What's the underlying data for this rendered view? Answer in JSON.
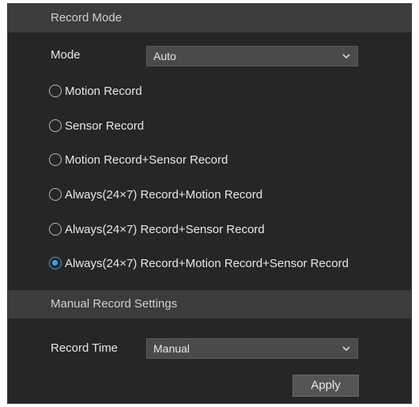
{
  "record_mode": {
    "header": "Record Mode",
    "mode_label": "Mode",
    "mode_value": "Auto",
    "options": [
      {
        "label": "Motion Record",
        "checked": false
      },
      {
        "label": "Sensor Record",
        "checked": false
      },
      {
        "label": "Motion Record+Sensor Record",
        "checked": false
      },
      {
        "label": "Always(24×7) Record+Motion Record",
        "checked": false
      },
      {
        "label": "Always(24×7) Record+Sensor Record",
        "checked": false
      },
      {
        "label": "Always(24×7) Record+Motion Record+Sensor Record",
        "checked": true
      }
    ]
  },
  "manual_settings": {
    "header": "Manual Record Settings",
    "record_time_label": "Record Time",
    "record_time_value": "Manual",
    "apply_label": "Apply"
  },
  "colors": {
    "panel_bg": "#262626",
    "header_bg": "#3c3c3c",
    "accent": "#3aa0e8"
  }
}
